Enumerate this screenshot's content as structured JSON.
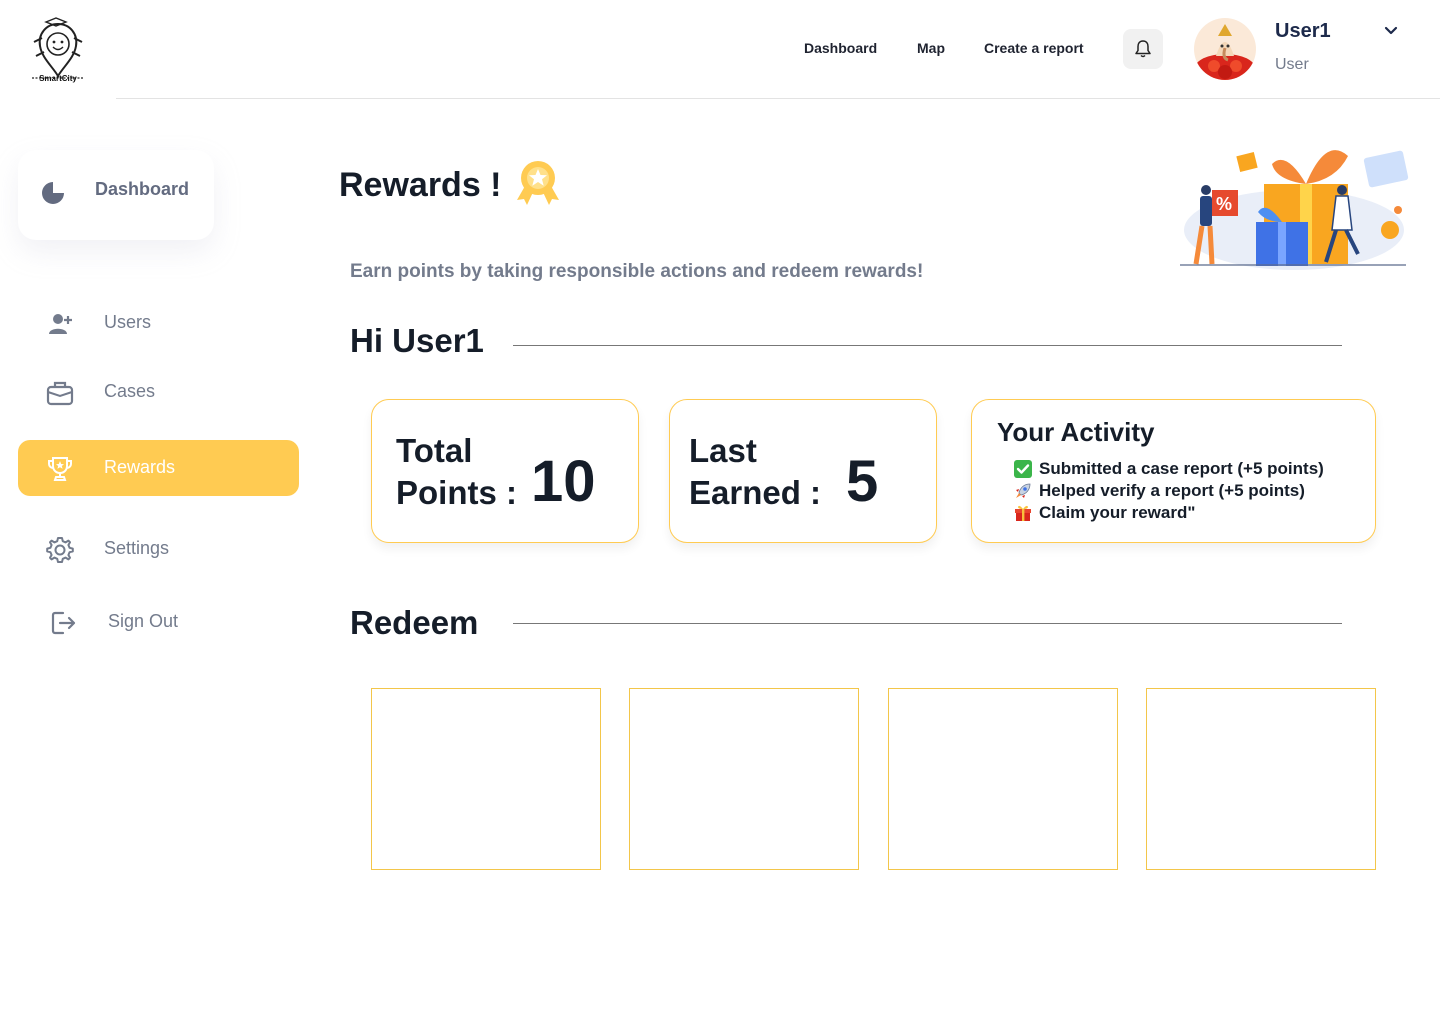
{
  "brand": {
    "logo_text": "SmartCity",
    "logo_icon": "smartcity-mascot-icon"
  },
  "topnav": {
    "items": [
      {
        "label": "Dashboard"
      },
      {
        "label": "Map"
      },
      {
        "label": "Create a report"
      }
    ],
    "bell_icon": "bell-icon"
  },
  "user": {
    "name": "User1",
    "role": "User"
  },
  "sidebar": {
    "dashboard_label": "Dashboard",
    "items": [
      {
        "label": "Users",
        "icon": "add-user-icon"
      },
      {
        "label": "Cases",
        "icon": "briefcase-icon"
      },
      {
        "label": "Rewards",
        "icon": "trophy-icon",
        "active": true
      },
      {
        "label": "Settings",
        "icon": "gear-icon"
      },
      {
        "label": "Sign Out",
        "icon": "sign-out-icon"
      }
    ]
  },
  "page": {
    "title": "Rewards !",
    "subtitle": "Earn points by taking responsible actions and redeem rewards!",
    "greeting": "Hi User1"
  },
  "stats": {
    "total_label_1": "Total",
    "total_label_2": "Points :",
    "total_value": "10",
    "last_label_1": "Last",
    "last_label_2": "Earned :",
    "last_value": "5"
  },
  "activity": {
    "title": "Your Activity",
    "items": [
      {
        "icon": "check-emoji-icon",
        "text": "Submitted a case report (+5 points)"
      },
      {
        "icon": "rocket-emoji-icon",
        "text": "Helped verify a report (+5 points)"
      },
      {
        "icon": "gift-emoji-icon",
        "text": "Claim your reward\""
      }
    ]
  },
  "redeem": {
    "title": "Redeem",
    "slots": 4
  },
  "colors": {
    "accent": "#ffcb52",
    "muted": "#737b8c",
    "text": "#151d29"
  }
}
